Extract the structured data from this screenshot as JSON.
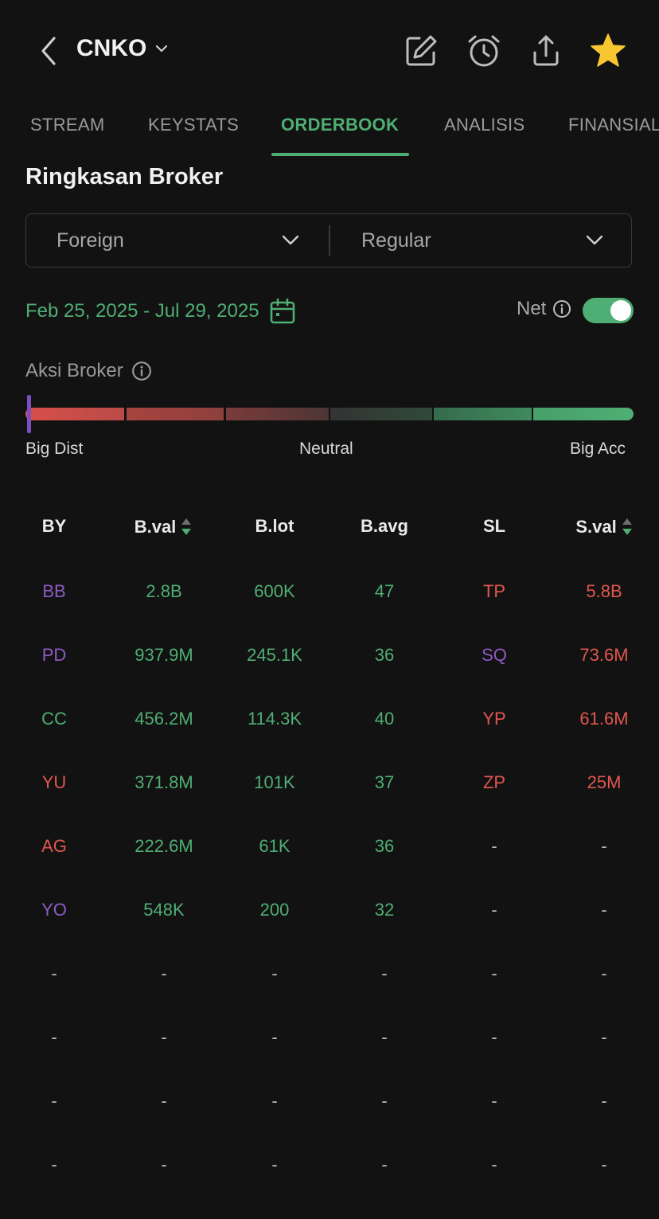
{
  "header": {
    "ticker": "CNKO",
    "icons": [
      "back-arrow-icon",
      "chevron-down-icon",
      "edit-icon",
      "alarm-icon",
      "share-icon",
      "star-icon"
    ]
  },
  "tabs": [
    {
      "label": "STREAM",
      "active": false
    },
    {
      "label": "KEYSTATS",
      "active": false
    },
    {
      "label": "ORDERBOOK",
      "active": true
    },
    {
      "label": "ANALISIS",
      "active": false
    },
    {
      "label": "FINANSIAL",
      "active": false
    }
  ],
  "section": {
    "title": "Ringkasan Broker",
    "filter_left": "Foreign",
    "filter_right": "Regular",
    "date_range": "Feb 25, 2025 - Jul 29, 2025",
    "net_label": "Net",
    "net_enabled": true,
    "aksi_label": "Aksi Broker",
    "scale": {
      "left": "Big Dist",
      "center": "Neutral",
      "right": "Big Acc"
    },
    "indicator_level": 0.0
  },
  "colors": {
    "accent_green": "#4fae73",
    "red": "#e0574f",
    "purple": "#8e5bc4",
    "background": "#121212"
  },
  "table": {
    "headers": [
      "BY",
      "B.val",
      "B.lot",
      "B.avg",
      "SL",
      "S.val"
    ],
    "rows": [
      {
        "by": "BB",
        "by_color": "purple",
        "bval": "2.8B",
        "blot": "600K",
        "bavg": "47",
        "sl": "TP",
        "sl_color": "red",
        "sval": "5.8B"
      },
      {
        "by": "PD",
        "by_color": "purple",
        "bval": "937.9M",
        "blot": "245.1K",
        "bavg": "36",
        "sl": "SQ",
        "sl_color": "purple",
        "sval": "73.6M"
      },
      {
        "by": "CC",
        "by_color": "green",
        "bval": "456.2M",
        "blot": "114.3K",
        "bavg": "40",
        "sl": "YP",
        "sl_color": "red",
        "sval": "61.6M"
      },
      {
        "by": "YU",
        "by_color": "red",
        "bval": "371.8M",
        "blot": "101K",
        "bavg": "37",
        "sl": "ZP",
        "sl_color": "red",
        "sval": "25M"
      },
      {
        "by": "AG",
        "by_color": "red",
        "bval": "222.6M",
        "blot": "61K",
        "bavg": "36",
        "sl": "-",
        "sl_color": "dash",
        "sval": "-"
      },
      {
        "by": "YO",
        "by_color": "purple",
        "bval": "548K",
        "blot": "200",
        "bavg": "32",
        "sl": "-",
        "sl_color": "dash",
        "sval": "-"
      },
      {
        "by": "-",
        "by_color": "dash",
        "bval": "-",
        "blot": "-",
        "bavg": "-",
        "sl": "-",
        "sl_color": "dash",
        "sval": "-"
      },
      {
        "by": "-",
        "by_color": "dash",
        "bval": "-",
        "blot": "-",
        "bavg": "-",
        "sl": "-",
        "sl_color": "dash",
        "sval": "-"
      },
      {
        "by": "-",
        "by_color": "dash",
        "bval": "-",
        "blot": "-",
        "bavg": "-",
        "sl": "-",
        "sl_color": "dash",
        "sval": "-"
      },
      {
        "by": "-",
        "by_color": "dash",
        "bval": "-",
        "blot": "-",
        "bavg": "-",
        "sl": "-",
        "sl_color": "dash",
        "sval": "-"
      }
    ]
  }
}
